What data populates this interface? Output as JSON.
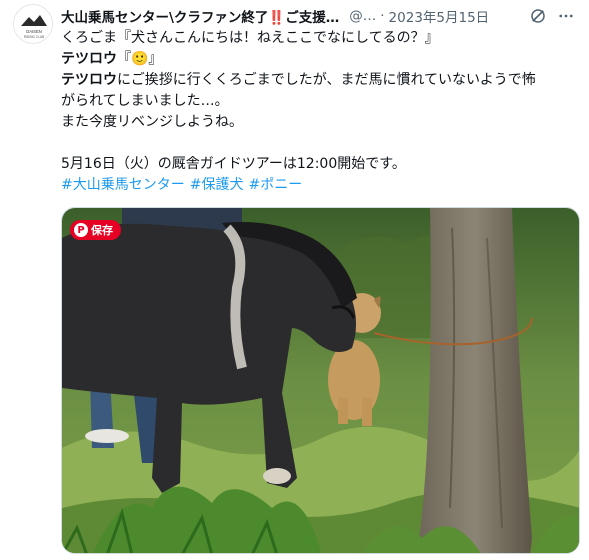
{
  "author": {
    "display_name": "大山乗馬センター\\クラファン終了‼️ご支援…",
    "handle": "@…",
    "date": "2023年5月15日",
    "avatar_text_1": "DAISEN",
    "avatar_text_2": "RIDING CLUB"
  },
  "tweet": {
    "line1": "くろごま『犬さんこんにちは！ねえここでなにしてるの？』",
    "line2_name": "テツロウ",
    "line2_rest": "『🙂』",
    "line3_name": "テツロウ",
    "line3_rest": "にご挨拶に行くくろごまでしたが、まだ馬に慣れていないようで怖",
    "line4": "がられてしまいました…。",
    "line5": "また今度リベンジしようね。",
    "line6": "5月16日（火）の厩舎ガイドツアーは12:00開始です。",
    "hashtags": [
      "#大山乗馬センター",
      "#保護犬",
      "#ポニー"
    ]
  },
  "media": {
    "pin_label": "保存",
    "pin_icon": "P"
  },
  "icons": {
    "grok": "grok-icon",
    "more": "more-icon",
    "pin": "pinterest-icon"
  }
}
